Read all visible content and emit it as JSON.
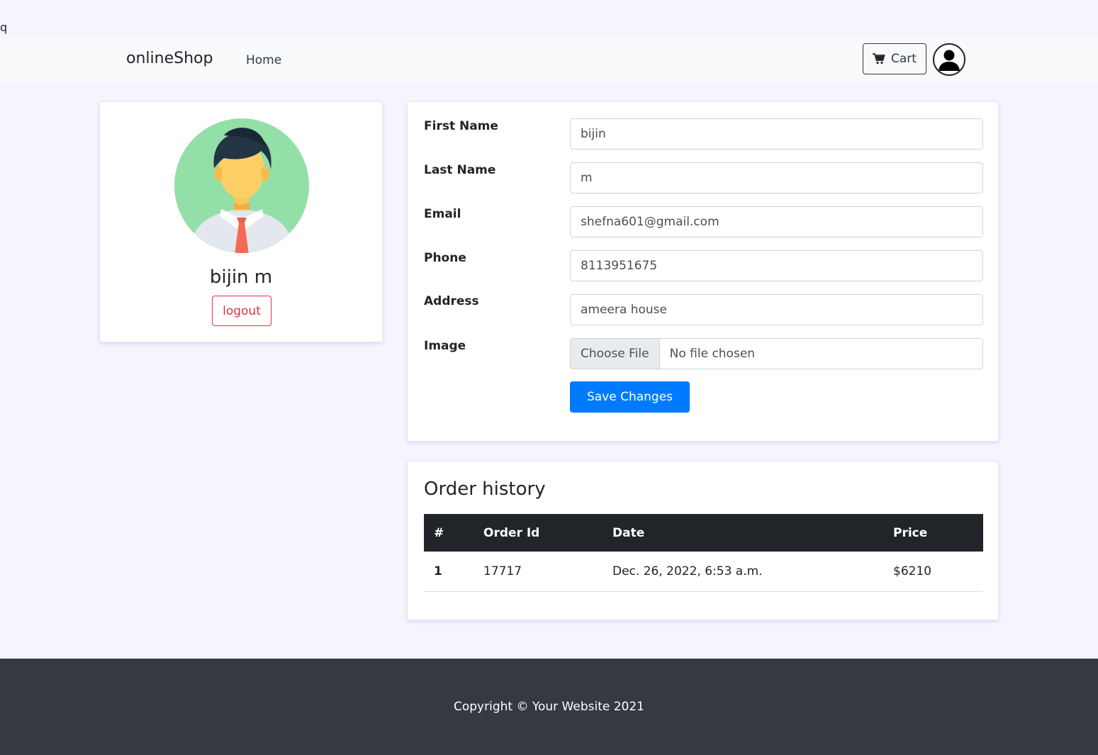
{
  "stray_text": "q",
  "navbar": {
    "brand": "onlineShop",
    "home_link": "Home",
    "cart_label": "Cart"
  },
  "profile": {
    "name": "bijin m",
    "logout_label": "logout"
  },
  "form": {
    "fields": [
      {
        "label": "First Name",
        "value": "bijin"
      },
      {
        "label": "Last Name",
        "value": "m"
      },
      {
        "label": "Email",
        "value": "shefna601@gmail.com"
      },
      {
        "label": "Phone",
        "value": "8113951675"
      },
      {
        "label": "Address",
        "value": "ameera house"
      }
    ],
    "image_label": "Image",
    "choose_file_label": "Choose File",
    "no_file_text": "No file chosen",
    "save_label": "Save Changes"
  },
  "orders": {
    "title": "Order history",
    "columns": [
      "#",
      "Order Id",
      "Date",
      "Price"
    ],
    "rows": [
      [
        "1",
        "17717",
        "Dec. 26, 2022, 6:53 a.m.",
        "$6210"
      ]
    ]
  },
  "footer": {
    "text": "Copyright © Your Website 2021"
  },
  "colors": {
    "primary": "#007bff",
    "danger": "#dc3545",
    "dark": "#212529",
    "footer": "#343a40"
  }
}
